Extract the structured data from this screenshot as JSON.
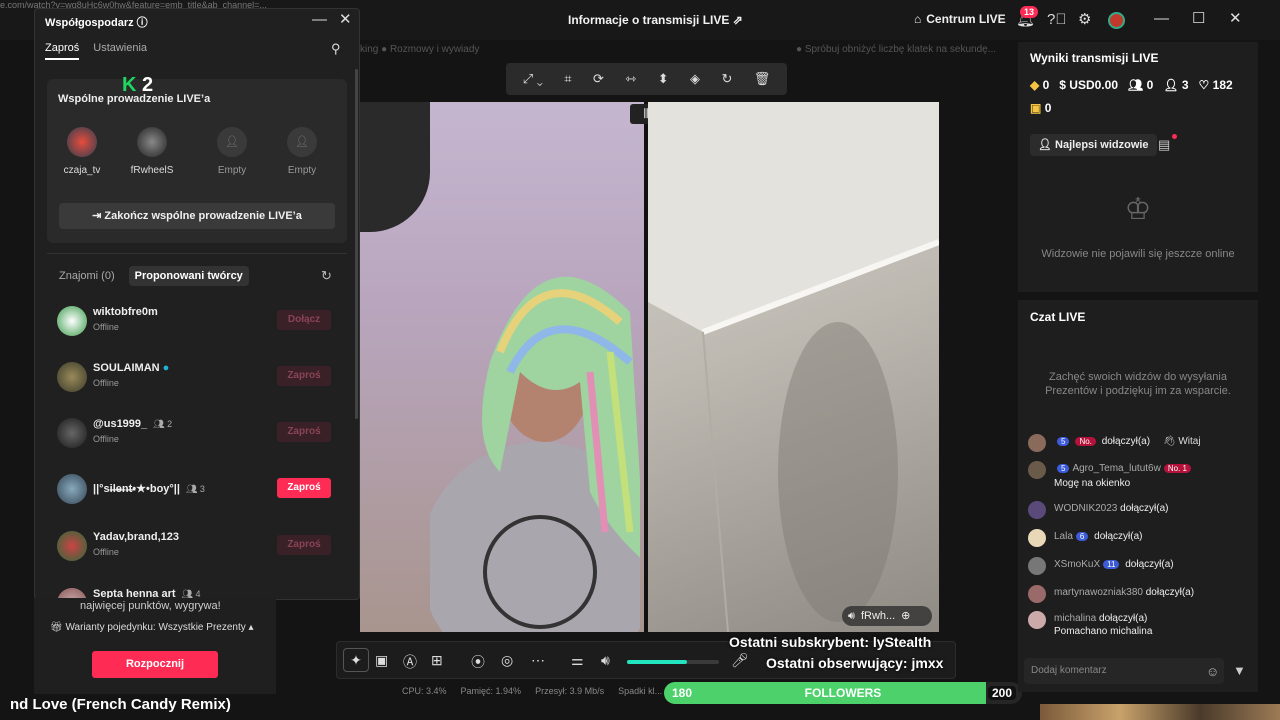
{
  "window": {
    "url_fragment": "e.com/watch?v=wq8uHc6w0hw&feature=emb_title&ab_channel=...",
    "title": "Informacje o transmisji LIVE",
    "centrum": "Centrum LIVE",
    "notif_count": "13"
  },
  "cohost": {
    "title": "Współgospodarz",
    "tabs": [
      "Zaproś",
      "Ustawienia"
    ],
    "card_title": "Wspólne prowadzenie LIVE’a",
    "slots": [
      {
        "name": "czaja_tv"
      },
      {
        "name": "fRwheelS"
      },
      {
        "name": "Empty"
      },
      {
        "name": "Empty"
      }
    ],
    "end_button": "Zakończ wspólne prowadzenie LIVE’a",
    "list_tabs": [
      "Znajomi (0)",
      "Proponowani twórcy"
    ],
    "creators": [
      {
        "name": "wiktobfre0m",
        "status": "Offline",
        "button": "Dołącz",
        "count": ""
      },
      {
        "name": "SOULAIMAN",
        "status": "Offline",
        "button": "Zaproś",
        "count": ""
      },
      {
        "name": "@us1999_",
        "status": "Offline",
        "button": "Zaproś",
        "count": "2"
      },
      {
        "name": "||°si̶l̶e̶n̶t̶•★•boy°||",
        "status": "",
        "button": "Zaproś",
        "count": "3"
      },
      {
        "name": "Yadav,brand,123",
        "status": "Offline",
        "button": "Zaproś",
        "count": ""
      },
      {
        "name": "Septa henna art",
        "status": "",
        "button": "Zaproś",
        "count": "4"
      }
    ]
  },
  "left_bottom": {
    "text": "najwięcej punktów, wygrywa!",
    "variants": "Warianty pojedynku: Wszystkie Prezenty",
    "start": "Rozpocznij",
    "song": "nd Love (French Candy Remix)"
  },
  "overlay": {
    "k2": "2",
    "sub": "Ostatni subskrybent: lyStealth",
    "follow": "Ostatni obserwujący: jmxx"
  },
  "faded": {
    "tags": "king   ● Rozmowy i wywiady",
    "right": "● Spróbuj obniżyć liczbę klatek na sekundę..."
  },
  "guest_tag": "fRwh...",
  "stats": {
    "cpu": "CPU: 3.4%",
    "mem": "Pamięć: 1.94%",
    "net": "Przesył: 3.9 Mb/s",
    "drops": "Spadki kl..."
  },
  "volume_level": 0.65,
  "followers": {
    "current": "180",
    "label": "FOLLOWERS",
    "goal": "200",
    "progress": 0.9
  },
  "results": {
    "title": "Wyniki transmisji LIVE",
    "diamonds": "0",
    "usd": "USD0.00",
    "viewers": "0",
    "people": "3",
    "likes": "182",
    "gifts": "0",
    "top_viewers": "Najlepsi widzowie",
    "no_viewers": "Widzowie nie pojawili się jeszcze online"
  },
  "chat": {
    "title": "Czat LIVE",
    "empty": "Zachęć swoich widzów do wysyłania Prezentów i podziękuj im za wsparcie.",
    "messages": [
      {
        "user": "",
        "level": "5",
        "rank": "No.",
        "text": "dołączył(a)",
        "extra": "Witaj"
      },
      {
        "user": "Agro_Tema_lutut6w",
        "level": "5",
        "rank": "No. 1",
        "text": "Mogę na okienko"
      },
      {
        "user": "WODNIK2023",
        "level": "",
        "rank": "",
        "text": "dołączył(a)"
      },
      {
        "user": "Lala",
        "level": "6",
        "rank": "",
        "text": "dołączył(a)"
      },
      {
        "user": "XSmoKuX",
        "level": "11",
        "rank": "",
        "text": "dołączył(a)"
      },
      {
        "user": "martynawozniak380",
        "level": "",
        "rank": "",
        "text": "dołączył(a)"
      },
      {
        "user": "michalina",
        "level": "",
        "rank": "",
        "text": "dołączył(a)",
        "extra": "Pomachano michalina"
      }
    ],
    "input_placeholder": "Dodaj komentarz"
  },
  "colors": {
    "accent": "#fe2c55",
    "progress": "#4cd16b",
    "volume": "#22e5c0"
  }
}
